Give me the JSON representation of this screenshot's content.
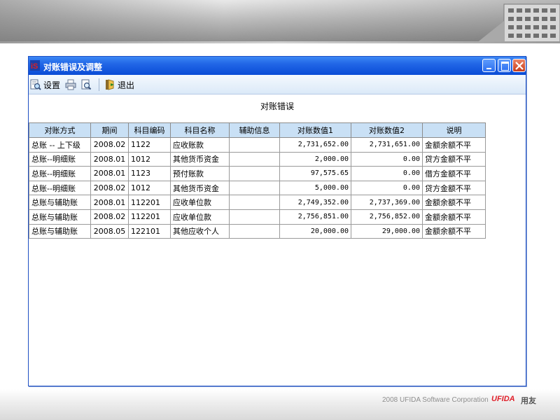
{
  "window": {
    "title": "对账错误及调整",
    "min_label": "",
    "max_label": "",
    "close_label": ""
  },
  "toolbar": {
    "settings_label": "设置",
    "exit_label": "退出"
  },
  "report": {
    "title": "对账错误"
  },
  "table": {
    "columns": [
      "对账方式",
      "期间",
      "科目编码",
      "科目名称",
      "辅助信息",
      "对账数值1",
      "对账数值2",
      "说明"
    ],
    "rows": [
      {
        "method": "总账 -- 上下级",
        "period": "2008.02",
        "code": "1122",
        "name": "应收账款",
        "aux": "",
        "value1": "2,731,652.00",
        "value2": "2,731,651.00",
        "note": "金额余额不平"
      },
      {
        "method": "总账--明细账",
        "period": "2008.01",
        "code": "1012",
        "name": "其他货币资金",
        "aux": "",
        "value1": "2,000.00",
        "value2": "0.00",
        "note": "贷方金额不平"
      },
      {
        "method": "总账--明细账",
        "period": "2008.01",
        "code": "1123",
        "name": "预付账款",
        "aux": "",
        "value1": "97,575.65",
        "value2": "0.00",
        "note": "借方金额不平"
      },
      {
        "method": "总账--明细账",
        "period": "2008.02",
        "code": "1012",
        "name": "其他货币资金",
        "aux": "",
        "value1": "5,000.00",
        "value2": "0.00",
        "note": "贷方金额不平"
      },
      {
        "method": "总账与辅助账",
        "period": "2008.01",
        "code": "112201",
        "name": "应收单位款",
        "aux": "",
        "value1": "2,749,352.00",
        "value2": "2,737,369.00",
        "note": "金额余额不平"
      },
      {
        "method": "总账与辅助账",
        "period": "2008.02",
        "code": "112201",
        "name": "应收单位款",
        "aux": "",
        "value1": "2,756,851.00",
        "value2": "2,756,852.00",
        "note": "金额余额不平"
      },
      {
        "method": "总账与辅助账",
        "period": "2008.05",
        "code": "122101",
        "name": "其他应收个人",
        "aux": "",
        "value1": "20,000.00",
        "value2": "29,000.00",
        "note": "金额余额不平"
      }
    ]
  },
  "footer": {
    "copyright": "2008 UFIDA Software Corporation",
    "brand": "UFIDA",
    "brand_cn": "用友"
  },
  "colors": {
    "titlebar": "#2166e6",
    "header_cell": "#c9e0f5",
    "brand_red": "#e0202a"
  },
  "icons": [
    "app-logo-icon",
    "settings-icon",
    "print-icon",
    "preview-icon",
    "exit-icon"
  ]
}
